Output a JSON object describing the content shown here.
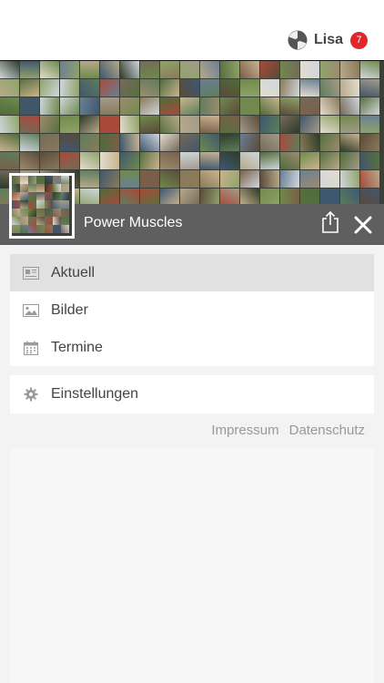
{
  "header": {
    "user_name": "Lisa",
    "notification_count": "7"
  },
  "group": {
    "name": "Power Muscles"
  },
  "menu": {
    "items": [
      {
        "label": "Aktuell",
        "icon": "newspaper-icon",
        "active": true
      },
      {
        "label": "Bilder",
        "icon": "image-icon",
        "active": false
      },
      {
        "label": "Termine",
        "icon": "calendar-icon",
        "active": false
      }
    ],
    "settings_label": "Einstellungen"
  },
  "footer": {
    "impressum": "Impressum",
    "datenschutz": "Datenschutz"
  },
  "colors": {
    "badge": "#e0262b",
    "group_bar": "#5f5f5f",
    "active_item": "#e1e1e1"
  }
}
